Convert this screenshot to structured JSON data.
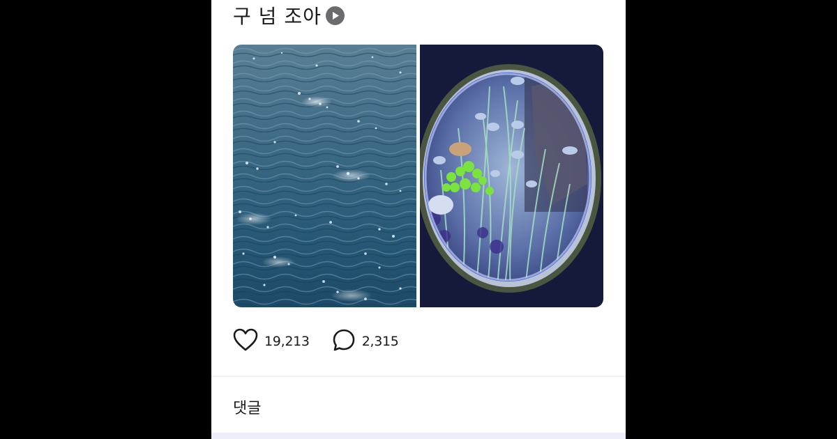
{
  "post": {
    "title": "구 넘 조아",
    "title_icon": "play-circle-icon"
  },
  "media": {
    "images": [
      {
        "subject": "sparkling-sea-water"
      },
      {
        "subject": "round-aquarium-window-with-fish"
      }
    ]
  },
  "actions": {
    "likes": "19,213",
    "comments": "2,315",
    "like_icon": "heart-outline-icon",
    "comment_icon": "speech-bubble-icon"
  },
  "comments_section": {
    "heading": "댓글"
  },
  "colors": {
    "page_background": "#000000",
    "panel_background": "#ffffff",
    "text": "#1a1a1a",
    "icon_gray": "#6b6b6f",
    "divider": "#f2f2f4",
    "bottom_strip": "#eeeefa"
  }
}
